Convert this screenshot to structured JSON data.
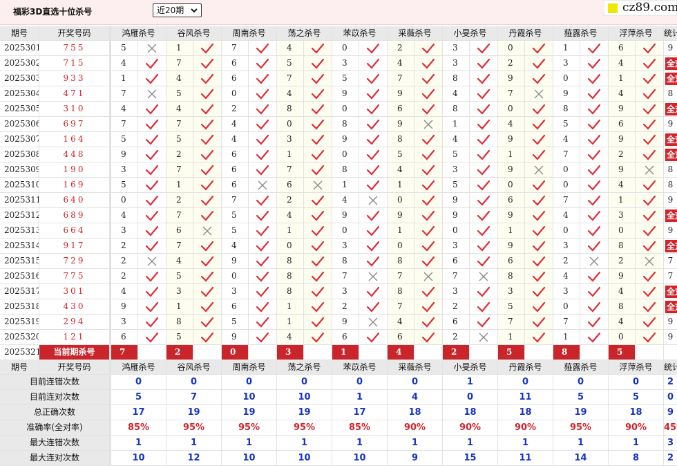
{
  "header": {
    "title": "福彩3D直选十位杀号",
    "period_selected": "近20期",
    "logo_text": "cz89.com"
  },
  "table": {
    "col_period": "期号",
    "col_draw": "开奖号码",
    "col_stat": "统计",
    "experts": [
      "鸿雁杀号",
      "谷风杀号",
      "周南杀号",
      "荡之杀号",
      "苯苡杀号",
      "采薇杀号",
      "小旻杀号",
      "丹霞杀号",
      "薤露杀号",
      "浮萍杀号"
    ],
    "rows": [
      {
        "period": "2025301",
        "draw": "755",
        "kills": [
          5,
          1,
          7,
          4,
          0,
          2,
          3,
          0,
          1,
          6
        ],
        "hits": [
          0,
          1,
          1,
          1,
          1,
          1,
          1,
          1,
          1,
          1
        ],
        "stat": "9"
      },
      {
        "period": "2025302",
        "draw": "715",
        "kills": [
          4,
          7,
          6,
          5,
          3,
          4,
          3,
          2,
          3,
          4
        ],
        "hits": [
          1,
          1,
          1,
          1,
          1,
          1,
          1,
          1,
          1,
          1
        ],
        "stat": "全对"
      },
      {
        "period": "2025303",
        "draw": "933",
        "kills": [
          1,
          4,
          6,
          7,
          5,
          7,
          8,
          9,
          0,
          1
        ],
        "hits": [
          1,
          1,
          1,
          1,
          1,
          1,
          1,
          1,
          1,
          1
        ],
        "stat": "全对"
      },
      {
        "period": "2025304",
        "draw": "471",
        "kills": [
          7,
          5,
          0,
          4,
          9,
          9,
          4,
          7,
          9,
          4
        ],
        "hits": [
          0,
          1,
          1,
          1,
          1,
          1,
          1,
          0,
          1,
          1
        ],
        "stat": "8"
      },
      {
        "period": "2025305",
        "draw": "310",
        "kills": [
          4,
          4,
          2,
          8,
          0,
          6,
          8,
          0,
          8,
          9
        ],
        "hits": [
          1,
          1,
          1,
          1,
          1,
          1,
          1,
          1,
          1,
          1
        ],
        "stat": "全对"
      },
      {
        "period": "2025306",
        "draw": "697",
        "kills": [
          7,
          7,
          4,
          0,
          8,
          9,
          1,
          4,
          5,
          6
        ],
        "hits": [
          1,
          1,
          1,
          1,
          1,
          0,
          1,
          1,
          1,
          1
        ],
        "stat": "9"
      },
      {
        "period": "2025307",
        "draw": "164",
        "kills": [
          5,
          5,
          4,
          3,
          9,
          8,
          4,
          9,
          4,
          9
        ],
        "hits": [
          1,
          1,
          1,
          1,
          1,
          1,
          1,
          1,
          1,
          1
        ],
        "stat": "全对"
      },
      {
        "period": "2025308",
        "draw": "448",
        "kills": [
          9,
          2,
          6,
          1,
          0,
          5,
          5,
          1,
          7,
          2
        ],
        "hits": [
          1,
          1,
          1,
          1,
          1,
          1,
          1,
          1,
          1,
          1
        ],
        "stat": "全对"
      },
      {
        "period": "2025309",
        "draw": "190",
        "kills": [
          3,
          7,
          6,
          7,
          8,
          4,
          3,
          9,
          0,
          9
        ],
        "hits": [
          1,
          1,
          1,
          1,
          1,
          1,
          1,
          0,
          1,
          0
        ],
        "stat": "8"
      },
      {
        "period": "2025310",
        "draw": "169",
        "kills": [
          5,
          1,
          6,
          6,
          1,
          1,
          5,
          0,
          0,
          4
        ],
        "hits": [
          1,
          1,
          0,
          0,
          1,
          1,
          1,
          1,
          1,
          1
        ],
        "stat": "8"
      },
      {
        "period": "2025311",
        "draw": "640",
        "kills": [
          0,
          2,
          7,
          2,
          4,
          0,
          9,
          6,
          7,
          1
        ],
        "hits": [
          1,
          1,
          1,
          1,
          0,
          1,
          1,
          1,
          1,
          1
        ],
        "stat": "9"
      },
      {
        "period": "2025312",
        "draw": "689",
        "kills": [
          4,
          7,
          5,
          4,
          9,
          9,
          9,
          9,
          4,
          3
        ],
        "hits": [
          1,
          1,
          1,
          1,
          1,
          1,
          1,
          1,
          1,
          1
        ],
        "stat": "全对"
      },
      {
        "period": "2025313",
        "draw": "664",
        "kills": [
          3,
          6,
          5,
          1,
          0,
          1,
          0,
          1,
          0,
          0
        ],
        "hits": [
          1,
          0,
          1,
          1,
          1,
          1,
          1,
          1,
          1,
          1
        ],
        "stat": "9"
      },
      {
        "period": "2025314",
        "draw": "917",
        "kills": [
          2,
          7,
          4,
          0,
          3,
          0,
          3,
          9,
          3,
          8
        ],
        "hits": [
          1,
          1,
          1,
          1,
          1,
          1,
          1,
          1,
          1,
          1
        ],
        "stat": "全对"
      },
      {
        "period": "2025315",
        "draw": "729",
        "kills": [
          2,
          4,
          9,
          8,
          8,
          8,
          6,
          6,
          2,
          2
        ],
        "hits": [
          0,
          1,
          1,
          1,
          1,
          1,
          1,
          1,
          0,
          0
        ],
        "stat": "7"
      },
      {
        "period": "2025316",
        "draw": "775",
        "kills": [
          2,
          5,
          0,
          8,
          7,
          7,
          7,
          8,
          4,
          9
        ],
        "hits": [
          1,
          1,
          1,
          1,
          0,
          0,
          0,
          1,
          1,
          1
        ],
        "stat": "7"
      },
      {
        "period": "2025317",
        "draw": "301",
        "kills": [
          4,
          3,
          3,
          8,
          3,
          8,
          3,
          3,
          3,
          4
        ],
        "hits": [
          1,
          1,
          1,
          1,
          1,
          1,
          1,
          1,
          1,
          1
        ],
        "stat": "全对"
      },
      {
        "period": "2025318",
        "draw": "430",
        "kills": [
          9,
          1,
          6,
          1,
          2,
          7,
          2,
          5,
          0,
          8
        ],
        "hits": [
          1,
          1,
          1,
          1,
          1,
          1,
          1,
          1,
          1,
          1
        ],
        "stat": "全对"
      },
      {
        "period": "2025319",
        "draw": "294",
        "kills": [
          3,
          8,
          5,
          1,
          9,
          4,
          6,
          7,
          7,
          4
        ],
        "hits": [
          1,
          1,
          1,
          1,
          0,
          1,
          1,
          1,
          1,
          1
        ],
        "stat": "9"
      },
      {
        "period": "2025320",
        "draw": "121",
        "kills": [
          6,
          5,
          9,
          4,
          6,
          6,
          2,
          1,
          1,
          0
        ],
        "hits": [
          1,
          1,
          1,
          1,
          1,
          1,
          0,
          1,
          1,
          1
        ],
        "stat": "9"
      }
    ],
    "current": {
      "period": "2025321",
      "label": "当前期杀号",
      "kills": [
        7,
        2,
        0,
        3,
        1,
        4,
        2,
        5,
        8,
        5
      ]
    },
    "summary": [
      {
        "label": "目前连错次数",
        "values": [
          "0",
          "0",
          "0",
          "0",
          "0",
          "0",
          "1",
          "0",
          "0",
          "0",
          "2"
        ]
      },
      {
        "label": "目前连对次数",
        "values": [
          "5",
          "7",
          "10",
          "10",
          "1",
          "4",
          "0",
          "11",
          "5",
          "5",
          "0"
        ]
      },
      {
        "label": "总正确次数",
        "values": [
          "17",
          "19",
          "19",
          "19",
          "17",
          "18",
          "18",
          "18",
          "19",
          "18",
          "9"
        ]
      },
      {
        "label": "准确率(全对率)",
        "values": [
          "85%",
          "95%",
          "95%",
          "95%",
          "85%",
          "90%",
          "90%",
          "90%",
          "95%",
          "90%",
          "45%"
        ],
        "red": true
      },
      {
        "label": "最大连错次数",
        "values": [
          "1",
          "1",
          "1",
          "1",
          "1",
          "1",
          "1",
          "1",
          "1",
          "1",
          "3"
        ]
      },
      {
        "label": "最大连对次数",
        "values": [
          "10",
          "12",
          "10",
          "10",
          "10",
          "9",
          "15",
          "11",
          "14",
          "8",
          "2"
        ]
      }
    ]
  },
  "colors": {
    "accent_red": "#d1232a",
    "header_gray": "#e9e9e9",
    "summary_blue": "#1533c7",
    "tick_red": "#e02b35",
    "cross_gray": "#8a8a8a",
    "logo_yellow": "#f1e800"
  },
  "icons": {
    "hit": "check-mark-icon",
    "miss": "cross-icon",
    "dropdown": "chevron-down-icon"
  }
}
